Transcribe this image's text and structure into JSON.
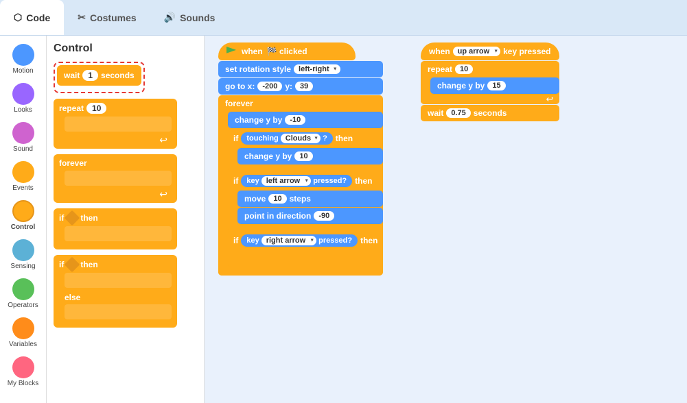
{
  "header": {
    "tabs": [
      {
        "id": "code",
        "label": "Code",
        "icon": "⬡",
        "active": true
      },
      {
        "id": "costumes",
        "label": "Costumes",
        "icon": "✂",
        "active": false
      },
      {
        "id": "sounds",
        "label": "Sounds",
        "icon": "🔊",
        "active": false
      }
    ]
  },
  "categories": [
    {
      "id": "motion",
      "label": "Motion",
      "color": "#4c97ff"
    },
    {
      "id": "looks",
      "label": "Looks",
      "color": "#9966ff"
    },
    {
      "id": "sound",
      "label": "Sound",
      "color": "#cf63cf"
    },
    {
      "id": "events",
      "label": "Events",
      "color": "#ffab19"
    },
    {
      "id": "control",
      "label": "Control",
      "color": "#ffab19",
      "active": true
    },
    {
      "id": "sensing",
      "label": "Sensing",
      "color": "#5cb1d6"
    },
    {
      "id": "operators",
      "label": "Operators",
      "color": "#59c059"
    },
    {
      "id": "variables",
      "label": "Variables",
      "color": "#ff8c1a"
    },
    {
      "id": "myblocks",
      "label": "My Blocks",
      "color": "#ff6680"
    }
  ],
  "panel": {
    "title": "Control",
    "blocks": [
      {
        "type": "wait",
        "label": "wait",
        "value": "1",
        "suffix": "seconds"
      },
      {
        "type": "repeat",
        "label": "repeat",
        "value": "10"
      },
      {
        "type": "forever",
        "label": "forever"
      },
      {
        "type": "if-then",
        "label": "if",
        "then": "then"
      },
      {
        "type": "if-then-else",
        "label": "if",
        "then": "then",
        "else": "else"
      }
    ]
  },
  "scripts": {
    "script1": {
      "hat": "when 🏁 clicked",
      "blocks": [
        {
          "type": "blue",
          "text": "set rotation style",
          "dropdown": "left-right"
        },
        {
          "type": "blue",
          "text": "go to x:",
          "val1": "-200",
          "text2": "y:",
          "val2": "39"
        },
        {
          "type": "forever",
          "inner": [
            {
              "type": "blue",
              "text": "change y by",
              "val": "-10"
            },
            {
              "type": "if-then",
              "condition": "touching Clouds ?",
              "inner": [
                {
                  "type": "blue",
                  "text": "change y by",
                  "val": "10"
                }
              ]
            },
            {
              "type": "if-then",
              "condition": "key left arrow pressed?",
              "then": true,
              "inner": [
                {
                  "type": "blue",
                  "text": "move",
                  "val": "10",
                  "suffix": "steps"
                },
                {
                  "type": "blue",
                  "text": "point in direction",
                  "val": "-90"
                }
              ]
            },
            {
              "type": "if-then",
              "condition": "key right arrow pressed?",
              "then": true,
              "inner": []
            }
          ]
        }
      ]
    },
    "script2": {
      "hat": "when up arrow ▼ key pressed",
      "blocks": [
        {
          "type": "repeat",
          "val": "10",
          "inner": [
            {
              "type": "blue",
              "text": "change y by",
              "val": "15"
            }
          ]
        },
        {
          "type": "orange",
          "text": "wait",
          "val": "0.75",
          "suffix": "seconds"
        }
      ]
    }
  }
}
